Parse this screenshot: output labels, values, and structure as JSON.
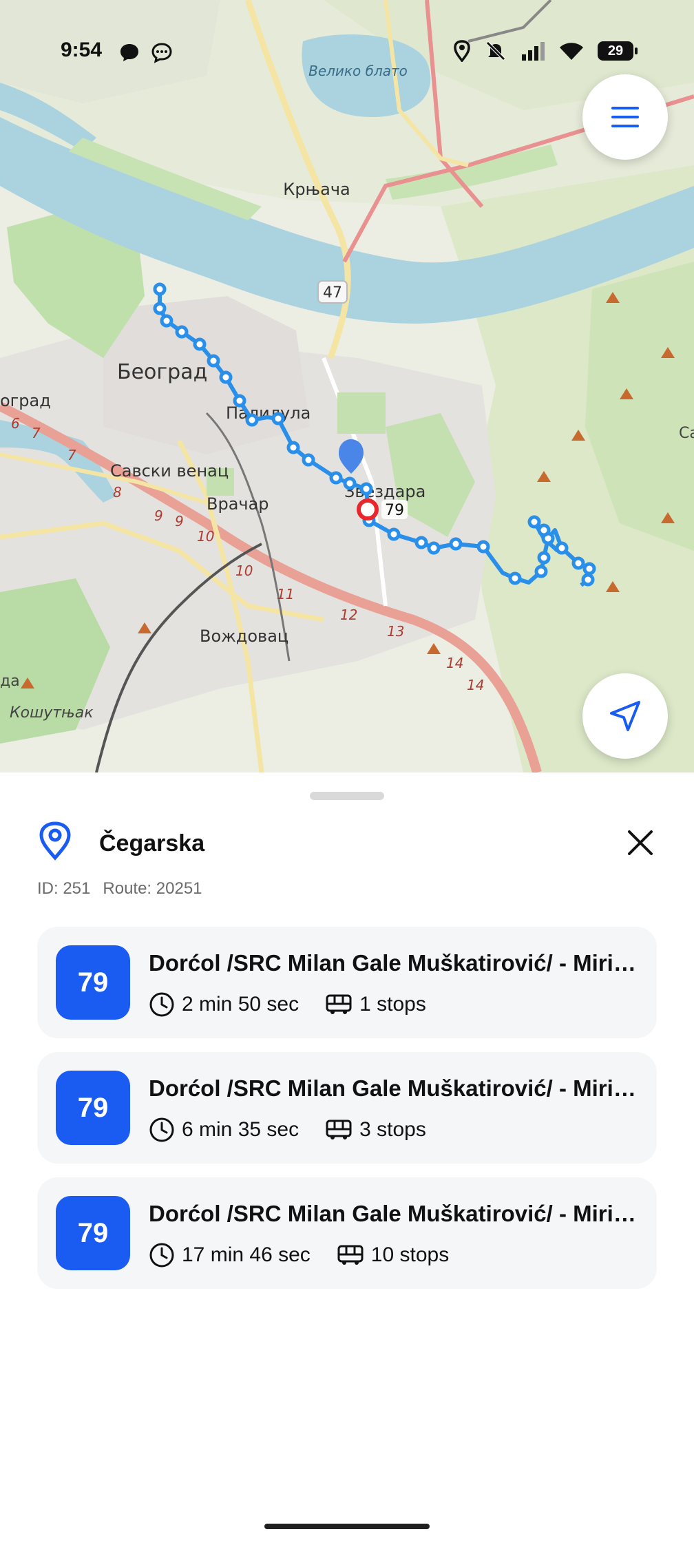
{
  "status_bar": {
    "time": "9:54",
    "battery": "29",
    "icons": [
      "message-icon",
      "chat-icon",
      "location-icon",
      "mute-icon",
      "signal-icon",
      "wifi-icon"
    ]
  },
  "map": {
    "labels": {
      "lake": "Велико блато",
      "krnjaca": "Крњача",
      "road_47": "47",
      "beograd": "Београд",
      "grad": "оград",
      "palilula": "Палилула",
      "savski": "Савски венац",
      "vracar": "Врачар",
      "zvezdara": "Звездара",
      "vozdovac": "Вождовац",
      "kosutnjak": "Кошутњак",
      "sa": "Са",
      "ga": "да",
      "marker_route": "79"
    },
    "road_numbers": [
      "6",
      "7",
      "7",
      "8",
      "9",
      "9",
      "10",
      "10",
      "11",
      "12",
      "13",
      "14",
      "14"
    ],
    "colors": {
      "route": "#2a8fe8",
      "river": "#aad3df",
      "stop_marker": "#e8262b",
      "location": "#4a86e8"
    }
  },
  "stop": {
    "name": "Čegarska",
    "id_label": "ID: 251",
    "route_label": "Route: 20251"
  },
  "arrivals": [
    {
      "line": "79",
      "title": "Dorćol /SRC Milan Gale Muškatirović/ - Mirijevo",
      "time": "2 min 50 sec",
      "stops": "1 stops"
    },
    {
      "line": "79",
      "title": "Dorćol /SRC Milan Gale Muškatirović/ - Mirijevo",
      "time": "6 min 35 sec",
      "stops": "3 stops"
    },
    {
      "line": "79",
      "title": "Dorćol /SRC Milan Gale Muškatirović/ - Mirijevo",
      "time": "17 min 46 sec",
      "stops": "10 stops"
    }
  ],
  "colors": {
    "accent": "#1a5cf2",
    "card_bg": "#f5f6f8"
  }
}
